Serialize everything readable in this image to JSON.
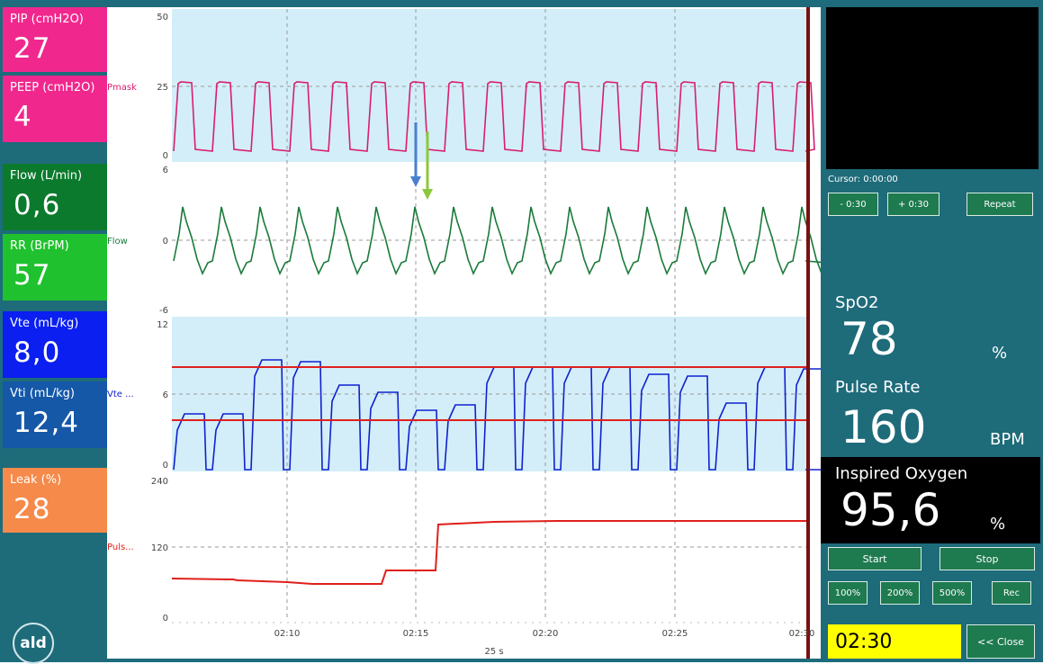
{
  "left_panel": {
    "tiles": [
      {
        "label": "PIP (cmH2O)",
        "value": "27",
        "color": "#f0288e"
      },
      {
        "label": "PEEP (cmH2O)",
        "value": "4",
        "color": "#f0288e"
      },
      {
        "label": "Flow (L/min)",
        "value": "0,6",
        "color": "#0b7a2c"
      },
      {
        "label": "RR (BrPM)",
        "value": "57",
        "color": "#1fc22e"
      },
      {
        "label": "Vte (mL/kg)",
        "value": "8,0",
        "color": "#0b1ff0"
      },
      {
        "label": "Vti (mL/kg)",
        "value": "12,4",
        "color": "#1558a8"
      },
      {
        "label": "Leak (%)",
        "value": "28",
        "color": "#f58a4a"
      }
    ],
    "logo": "ald"
  },
  "plot": {
    "pressure": {
      "label": "Pmask",
      "ticks": [
        "50",
        "25",
        "0"
      ],
      "color": "#d81e6c"
    },
    "flow": {
      "label": "Flow",
      "ticks": [
        "6",
        "0",
        "-6"
      ],
      "color": "#1a7a3a"
    },
    "volume": {
      "label": "Vte ...",
      "ticks": [
        "12",
        "6",
        "0"
      ],
      "color": "#1020d0"
    },
    "pulse": {
      "label": "Puls...",
      "ticks": [
        "240",
        "120",
        "0"
      ],
      "color": "#e0201a"
    },
    "x_ticks": [
      "02:10",
      "02:15",
      "02:20",
      "02:25",
      "02:30"
    ],
    "x_span": "25 s"
  },
  "right_panel": {
    "cursor": "Cursor: 0:00:00",
    "buttons": {
      "minus": "- 0:30",
      "plus": "+ 0:30",
      "repeat": "Repeat",
      "start": "Start",
      "stop": "Stop",
      "zoom100": "100%",
      "zoom200": "200%",
      "zoom500": "500%",
      "rec": "Rec",
      "close": "<< Close"
    },
    "spo2": {
      "label": "SpO2",
      "value": "78",
      "unit": "%"
    },
    "pulse": {
      "label": "Pulse Rate",
      "value": "160",
      "unit": "BPM"
    },
    "oxygen": {
      "label": "Inspired Oxygen",
      "value": "95,6",
      "unit": "%"
    },
    "timer": "02:30"
  }
}
